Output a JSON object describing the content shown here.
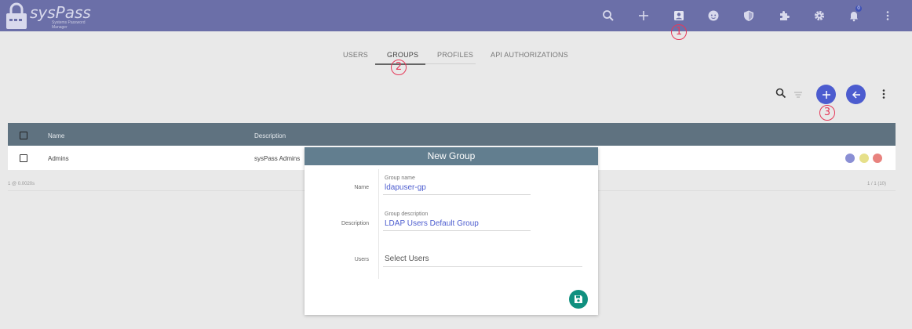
{
  "app": {
    "name": "sysPass",
    "tagline": "Systems Password Manager"
  },
  "topbar": {
    "notification_count": "0",
    "icons": [
      "search-icon",
      "add-icon",
      "account-box-icon",
      "face-icon",
      "shield-icon",
      "extension-icon",
      "gear-icon",
      "bell-icon",
      "more-vert-icon"
    ]
  },
  "markers": {
    "one": "1",
    "two": "2",
    "three": "3"
  },
  "tabs": [
    {
      "label": "USERS"
    },
    {
      "label": "GROUPS"
    },
    {
      "label": "PROFILES"
    },
    {
      "label": "API AUTHORIZATIONS"
    }
  ],
  "table": {
    "columns": [
      "Name",
      "Description"
    ],
    "rows": [
      {
        "name": "Admins",
        "description": "sysPass Admins"
      }
    ],
    "footer_left": "1 @ 0.0020s",
    "footer_right": "1 / 1 (10)"
  },
  "modal": {
    "title": "New Group",
    "name_label": "Name",
    "name_hint": "Group name",
    "name_value": "ldapuser-gp",
    "desc_label": "Description",
    "desc_hint": "Group description",
    "desc_value": "LDAP Users Default Group",
    "users_label": "Users",
    "users_placeholder": "Select Users"
  },
  "colors": {
    "topbar": "#6b6fa8",
    "accent": "#4c5ccf",
    "table_header": "#5f7280",
    "modal_header": "#627e8f",
    "save": "#10907f",
    "marker": "#e53959"
  }
}
